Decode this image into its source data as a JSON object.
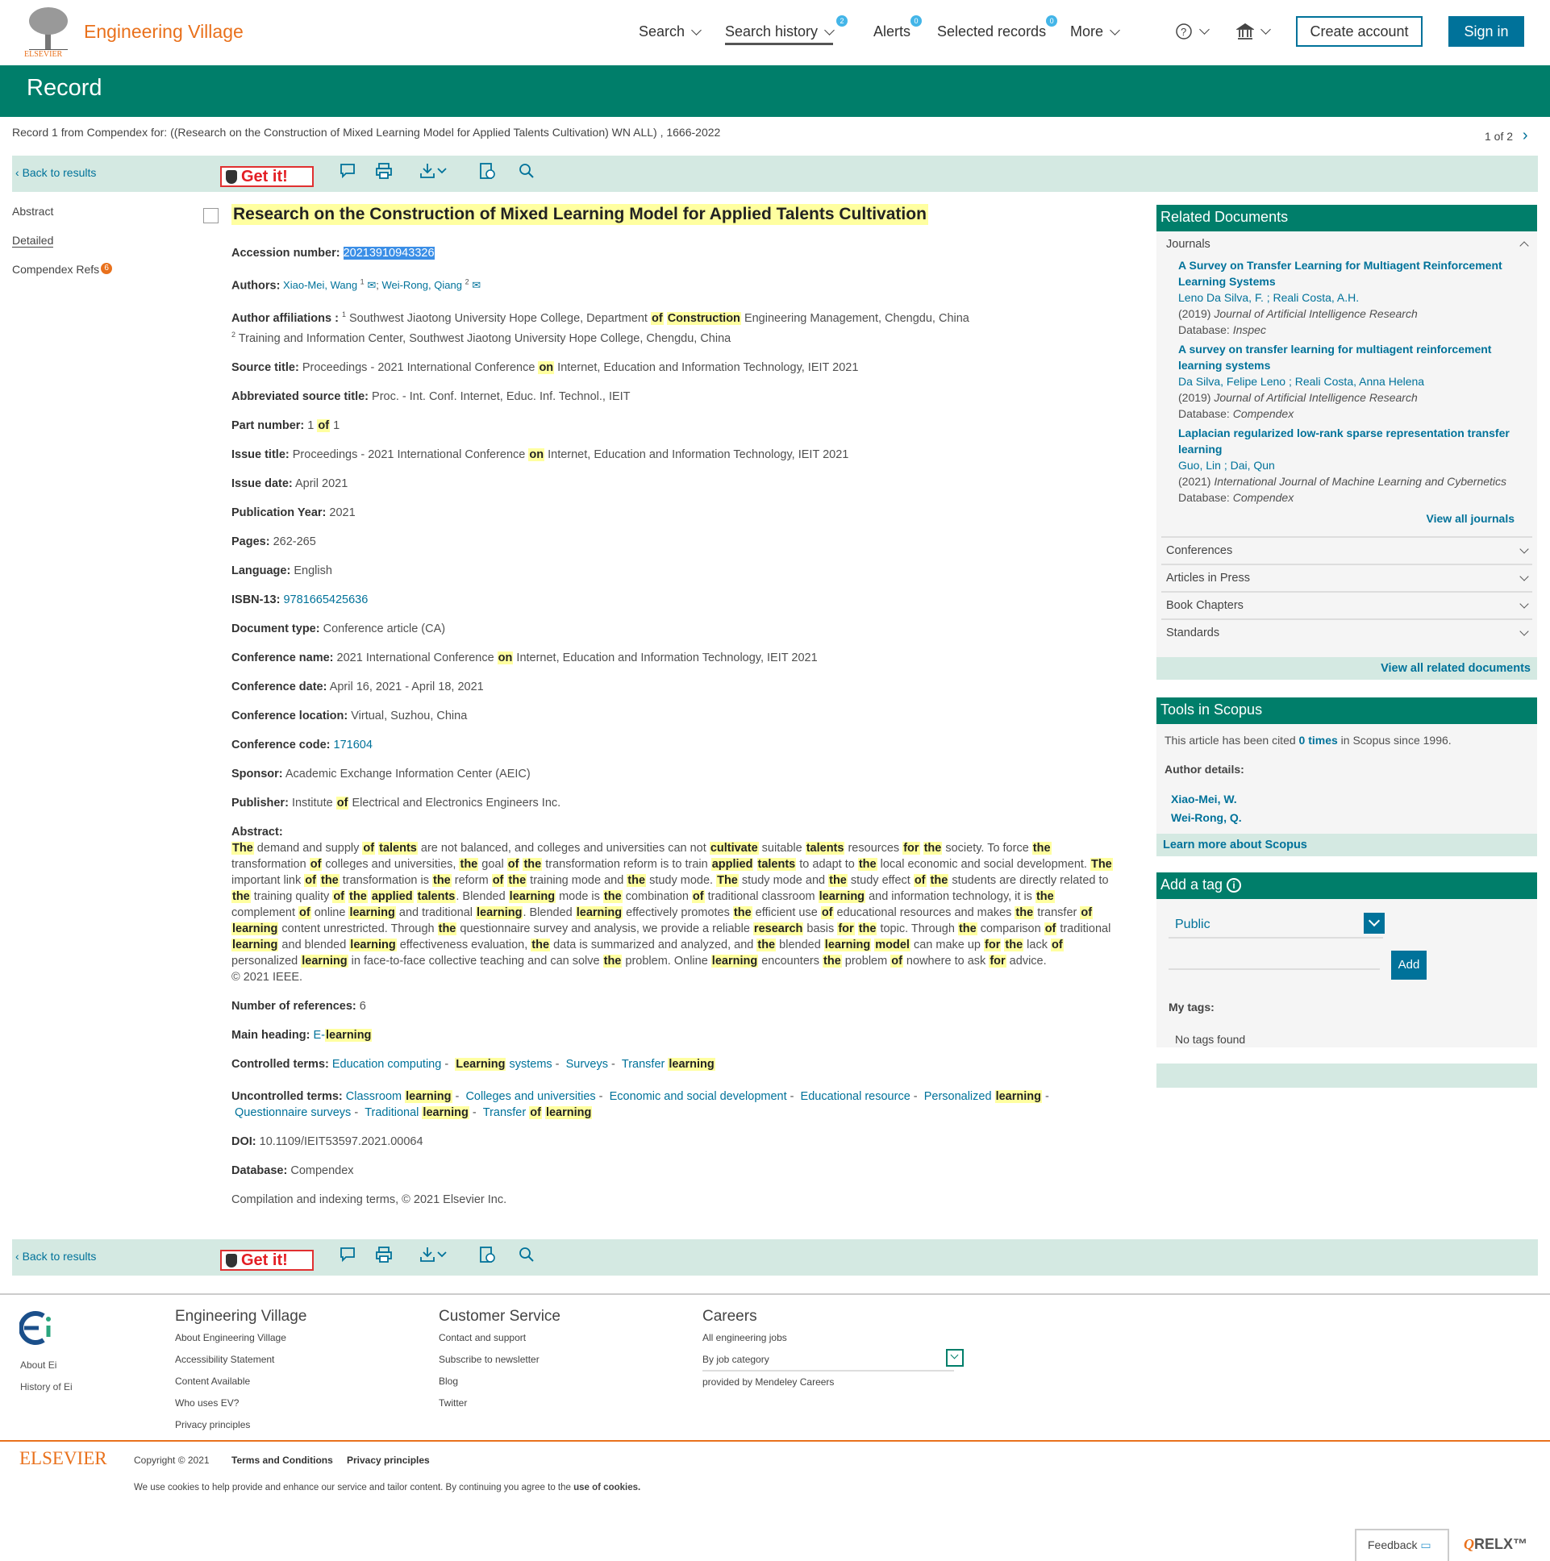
{
  "header": {
    "brand": "Engineering Village",
    "logo_text": "ELSEVIER",
    "nav": [
      {
        "label": "Search"
      },
      {
        "label": "Search history",
        "badge": "2"
      },
      {
        "label": "Alerts",
        "badge": "0"
      },
      {
        "label": "Selected records",
        "badge": "0"
      },
      {
        "label": "More"
      }
    ],
    "create_account": "Create account",
    "sign_in": "Sign in"
  },
  "page_title": "Record",
  "record_line": "Record 1 from Compendex for: ((Research on the Construction of Mixed Learning Model for Applied Talents Cultivation) WN ALL) , 1666-2022",
  "pager": "1 of 2",
  "toolbar": {
    "back": "Back to results",
    "getit": "Get it!"
  },
  "left_nav": [
    "Abstract",
    "Detailed",
    "Compendex Refs"
  ],
  "refs_badge": "6",
  "highlight_terms": [
    "research",
    "on",
    "the",
    "construction",
    "of",
    "mixed",
    "learning",
    "model",
    "for",
    "applied",
    "talents",
    "cultivate"
  ],
  "title": "Research on the Construction of Mixed Learning Model for Applied Talents Cultivation",
  "accession": {
    "label": "Accession number:",
    "value": "20213910943326"
  },
  "authors": {
    "label": "Authors:",
    "list": [
      {
        "name": "Xiao-Mei, Wang",
        "sup": "1"
      },
      {
        "name": "Wei-Rong, Qiang",
        "sup": "2"
      }
    ]
  },
  "affiliations": {
    "label": "Author affiliations :",
    "list": [
      {
        "sup": "1",
        "text": "Southwest Jiaotong University Hope College, Department of Construction Engineering Management, Chengdu, China"
      },
      {
        "sup": "2",
        "text": "Training and Information Center, Southwest Jiaotong University Hope College, Chengdu, China"
      }
    ]
  },
  "fields1": [
    {
      "label": "Source title:",
      "value": "Proceedings - 2021 International Conference on Internet, Education and Information Technology, IEIT 2021"
    },
    {
      "label": "Abbreviated source title:",
      "value": "Proc. - Int. Conf. Internet, Educ. Inf. Technol., IEIT"
    },
    {
      "label": "Part number:",
      "value": "1 of 1"
    },
    {
      "label": "Issue title:",
      "value": "Proceedings - 2021 International Conference on Internet, Education and Information Technology, IEIT 2021"
    },
    {
      "label": "Issue date:",
      "value": "April 2021"
    },
    {
      "label": "Publication Year:",
      "value": "2021"
    },
    {
      "label": "Pages:",
      "value": "262-265"
    },
    {
      "label": "Language:",
      "value": "English"
    },
    {
      "label": "ISBN-13:",
      "value": "9781665425636",
      "link": true
    },
    {
      "label": "Document type:",
      "value": "Conference article (CA)"
    },
    {
      "label": "Conference name:",
      "value": "2021 International Conference on Internet, Education and Information Technology, IEIT 2021"
    },
    {
      "label": "Conference date:",
      "value": "April 16, 2021 - April 18, 2021"
    },
    {
      "label": "Conference location:",
      "value": "Virtual, Suzhou, China"
    },
    {
      "label": "Conference code:",
      "value": "171604",
      "link": true
    },
    {
      "label": "Sponsor:",
      "value": "Academic Exchange Information Center (AEIC)"
    },
    {
      "label": "Publisher:",
      "value": "Institute of Electrical and Electronics Engineers Inc."
    }
  ],
  "abstract": {
    "label": "Abstract:",
    "text": "The demand and supply of talents are not balanced, and colleges and universities can not cultivate suitable talents resources for the society. To force the transformation of colleges and universities, the goal of the transformation reform is to train applied talents to adapt to the local economic and social development. The important link of the transformation is the reform of the training mode and the study mode. The study mode and the study effect of the students are directly related to the training quality of the applied talents. Blended learning mode is the combination of traditional classroom learning and information technology, it is the complement of online learning and traditional learning. Blended learning effectively promotes the efficient use of educational resources and makes the transfer of learning content unrestricted. Through the questionnaire survey and analysis, we provide a reliable research basis for the topic. Through the comparison of traditional learning and blended learning effectiveness evaluation, the data is summarized and analyzed, and the blended learning model can make up for the lack of personalized learning in face-to-face collective teaching and can solve the problem. Online learning encounters the problem of nowhere to ask for advice.",
    "copyright": "© 2021 IEEE."
  },
  "num_refs": {
    "label": "Number of references:",
    "value": "6"
  },
  "main_heading": {
    "label": "Main heading:",
    "value": "E-learning"
  },
  "controlled": {
    "label": "Controlled terms:",
    "terms": [
      "Education computing",
      "Learning systems",
      "Surveys",
      "Transfer learning"
    ]
  },
  "uncontrolled": {
    "label": "Uncontrolled terms:",
    "terms": [
      "Classroom learning",
      "Colleges and universities",
      "Economic and social development",
      "Educational resource",
      "Personalized learning",
      "Questionnaire surveys",
      "Traditional learning",
      "Transfer of learning"
    ]
  },
  "fields2": [
    {
      "label": "DOI:",
      "value": "10.1109/IEIT53597.2021.00064"
    },
    {
      "label": "Database:",
      "value": "Compendex"
    }
  ],
  "compilation": "Compilation and indexing terms, © 2021 Elsevier Inc.",
  "related": {
    "title": "Related Documents",
    "journals_label": "Journals",
    "journals": [
      {
        "title": "A Survey on Transfer Learning for Multiagent Reinforcement Learning Systems",
        "authors": "Leno Da Silva, F. ; Reali Costa, A.H.",
        "year": "(2019)",
        "source": "Journal of Artificial Intelligence Research",
        "db_label": "Database:",
        "db": "Inspec"
      },
      {
        "title": "A survey on transfer learning for multiagent reinforcement learning systems",
        "authors": "Da Silva, Felipe Leno ; Reali Costa, Anna Helena",
        "year": "(2019)",
        "source": "Journal of Artificial Intelligence Research",
        "db_label": "Database:",
        "db": "Compendex"
      },
      {
        "title": "Laplacian regularized low-rank sparse representation transfer learning",
        "authors": "Guo, Lin ; Dai, Qun",
        "year": "(2021)",
        "source": "International Journal of Machine Learning and Cybernetics",
        "db_label": "Database:",
        "db": "Compendex"
      }
    ],
    "view_journals": "View all journals",
    "sections": [
      "Conferences",
      "Articles in Press",
      "Book Chapters",
      "Standards"
    ],
    "view_all": "View all related documents"
  },
  "scopus": {
    "title": "Tools in Scopus",
    "cited_pre": "This article has been cited ",
    "cited_link": "0 times",
    "cited_post": " in Scopus since 1996.",
    "author_label": "Author details:",
    "authors": [
      "Xiao-Mei, W.",
      "Wei-Rong, Q."
    ],
    "learn": "Learn more about Scopus"
  },
  "tag": {
    "title": "Add a tag",
    "visibility": "Public",
    "add": "Add",
    "my_tags": "My tags:",
    "none": "No tags found"
  },
  "footer": {
    "ei": [
      "About Ei",
      "History of Ei"
    ],
    "cols": [
      {
        "title": "Engineering Village",
        "links": [
          "About Engineering Village",
          "Accessibility Statement",
          "Content Available",
          "Who uses EV?",
          "Privacy principles"
        ]
      },
      {
        "title": "Customer Service",
        "links": [
          "Contact and support",
          "Subscribe to newsletter",
          "Blog",
          "Twitter"
        ]
      }
    ],
    "careers": {
      "title": "Careers",
      "all": "All engineering jobs",
      "category": "By job category",
      "provided": "provided by Mendeley Careers"
    },
    "elsevier": "ELSEVIER",
    "copyright": "Copyright © 2021",
    "terms": "Terms and Conditions",
    "privacy": "Privacy principles",
    "cookies_pre": "We use cookies to help provide and enhance our service and tailor content. By continuing you agree to the ",
    "cookies_link": "use of cookies.",
    "feedback": "Feedback",
    "relx": "RELX™"
  },
  "colors": {
    "green": "#007e6a",
    "link": "#00729a",
    "orange": "#e9711c",
    "highlight": "#ffffa0"
  }
}
